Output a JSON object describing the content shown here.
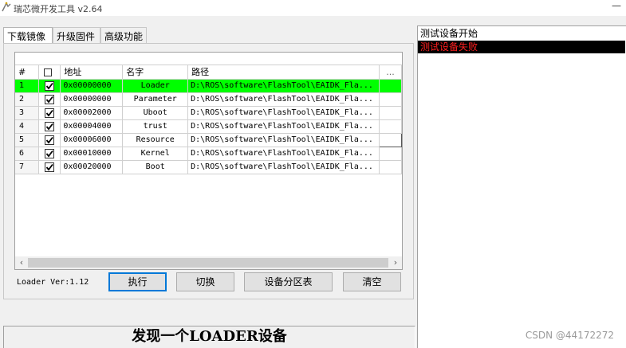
{
  "window": {
    "title": "瑞芯微开发工具 v2.64",
    "close_glyph": "—"
  },
  "tabs": [
    {
      "label": "下载镜像",
      "active": true
    },
    {
      "label": "升级固件",
      "active": false
    },
    {
      "label": "高级功能",
      "active": false
    }
  ],
  "table": {
    "columns": [
      "#",
      "",
      "地址",
      "名字",
      "路径",
      "..."
    ],
    "rows": [
      {
        "num": "1",
        "checked": true,
        "addr": "0x00000000",
        "name": "Loader",
        "path": "D:\\ROS\\software\\FlashTool\\EAIDK_Fla...",
        "selected": true
      },
      {
        "num": "2",
        "checked": true,
        "addr": "0x00000000",
        "name": "Parameter",
        "path": "D:\\ROS\\software\\FlashTool\\EAIDK_Fla...",
        "selected": false
      },
      {
        "num": "3",
        "checked": true,
        "addr": "0x00002000",
        "name": "Uboot",
        "path": "D:\\ROS\\software\\FlashTool\\EAIDK_Fla...",
        "selected": false
      },
      {
        "num": "4",
        "checked": true,
        "addr": "0x00004000",
        "name": "trust",
        "path": "D:\\ROS\\software\\FlashTool\\EAIDK_Fla...",
        "selected": false
      },
      {
        "num": "5",
        "checked": true,
        "addr": "0x00006000",
        "name": "Resource",
        "path": "D:\\ROS\\software\\FlashTool\\EAIDK_Fla...",
        "selected": false
      },
      {
        "num": "6",
        "checked": true,
        "addr": "0x00010000",
        "name": "Kernel",
        "path": "D:\\ROS\\software\\FlashTool\\EAIDK_Fla...",
        "selected": false
      },
      {
        "num": "7",
        "checked": true,
        "addr": "0x00020000",
        "name": "Boot",
        "path": "D:\\ROS\\software\\FlashTool\\EAIDK_Fla...",
        "selected": false
      }
    ]
  },
  "loader_version": "Loader Ver:1.12",
  "buttons": {
    "run": "执行",
    "switch": "切换",
    "partition": "设备分区表",
    "clear": "清空"
  },
  "status": "发现一个LOADER设备",
  "log": [
    {
      "text": "测试设备开始",
      "type": "normal"
    },
    {
      "text": "测试设备失败",
      "type": "error"
    }
  ],
  "watermark": "CSDN @44172272",
  "colors": {
    "selected_row": "#00ff00",
    "error_text": "#ff2020",
    "error_bg": "#000000",
    "default_button_border": "#0078d7"
  },
  "icons": {
    "app": "app-icon",
    "scroll_left": "chevron-left-icon",
    "scroll_right": "chevron-right-icon",
    "checkbox": "check-icon"
  }
}
